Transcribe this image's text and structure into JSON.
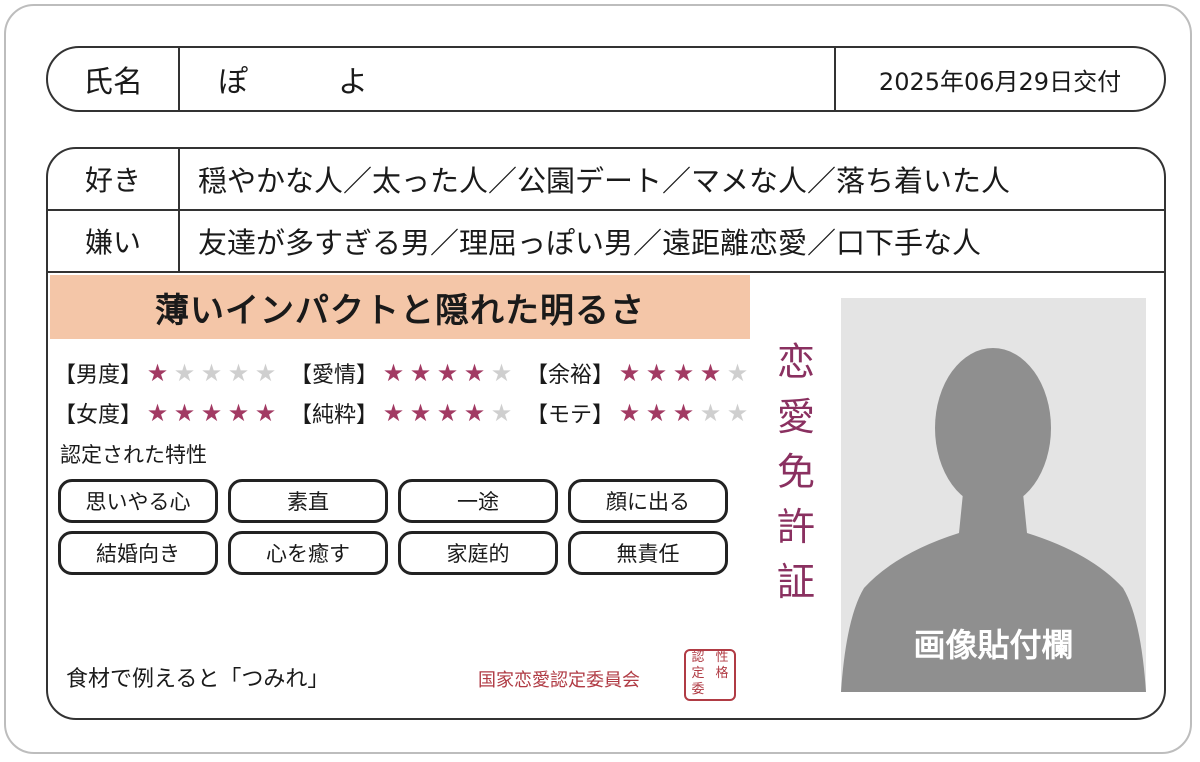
{
  "name_row": {
    "label": "氏名",
    "value": "ぽ　　　よ",
    "issue_date": "2025年06月29日交付"
  },
  "likes": {
    "label": "好き",
    "value": "穏やかな人／太った人／公園デート／マメな人／落ち着いた人"
  },
  "dislikes": {
    "label": "嫌い",
    "value": "友達が多すぎる男／理屈っぽい男／遠距離恋愛／口下手な人"
  },
  "headline": "薄いインパクトと隠れた明るさ",
  "ratings": [
    {
      "label": "【男度】",
      "value": 1,
      "max": 5
    },
    {
      "label": "【愛情】",
      "value": 4,
      "max": 5
    },
    {
      "label": "【余裕】",
      "value": 4,
      "max": 5
    },
    {
      "label": "【女度】",
      "value": 5,
      "max": 5
    },
    {
      "label": "【純粋】",
      "value": 4,
      "max": 5
    },
    {
      "label": "【モテ】",
      "value": 3,
      "max": 5
    }
  ],
  "star_colors": {
    "on": "#a23a63",
    "off": "#cfcfcf"
  },
  "traits_title": "認定された特性",
  "traits": [
    "思いやる心",
    "素直",
    "一途",
    "顔に出る",
    "結婚向き",
    "心を癒す",
    "家庭的",
    "無責任"
  ],
  "food": "食材で例えると「つみれ」",
  "committee": "国家恋愛認定委員会",
  "seal_chars": [
    "認",
    "性",
    "定",
    "格",
    "委",
    ""
  ],
  "vertical_title": [
    "恋",
    "愛",
    "免",
    "許",
    "証"
  ],
  "photo_label": "画像貼付欄",
  "accent_colors": {
    "headline_bg": "#f4c6a8",
    "title": "#8a3060",
    "seal": "#b03b44"
  }
}
